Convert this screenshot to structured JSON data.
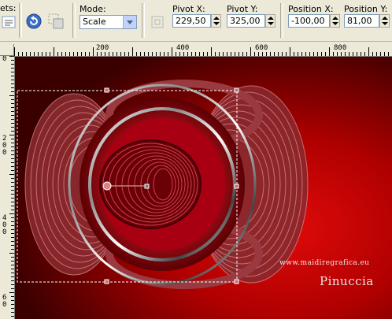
{
  "toolbar": {
    "presets_label": "ets:",
    "mode": {
      "label": "Mode:",
      "value": "Scale"
    },
    "pivot_x": {
      "label": "Pivot X:",
      "value": "229,50"
    },
    "pivot_y": {
      "label": "Pivot Y:",
      "value": "325,00"
    },
    "position_x": {
      "label": "Position X:",
      "value": "-100,00"
    },
    "position_y": {
      "label": "Position Y:",
      "value": "81,00"
    }
  },
  "ruler": {
    "top_labels": [
      "200",
      "400",
      "600",
      "800"
    ],
    "left_labels": [
      "0",
      "2\n0\n0",
      "4\n0\n0",
      "6\n0"
    ]
  },
  "watermark": {
    "name": "Pinuccia",
    "url": "www.maidiregrafica.eu"
  },
  "colors": {
    "background_dark": "#3a0000",
    "background_red": "#c80000",
    "ring_red": "#b0101a",
    "selection_border": "#ffffff"
  }
}
